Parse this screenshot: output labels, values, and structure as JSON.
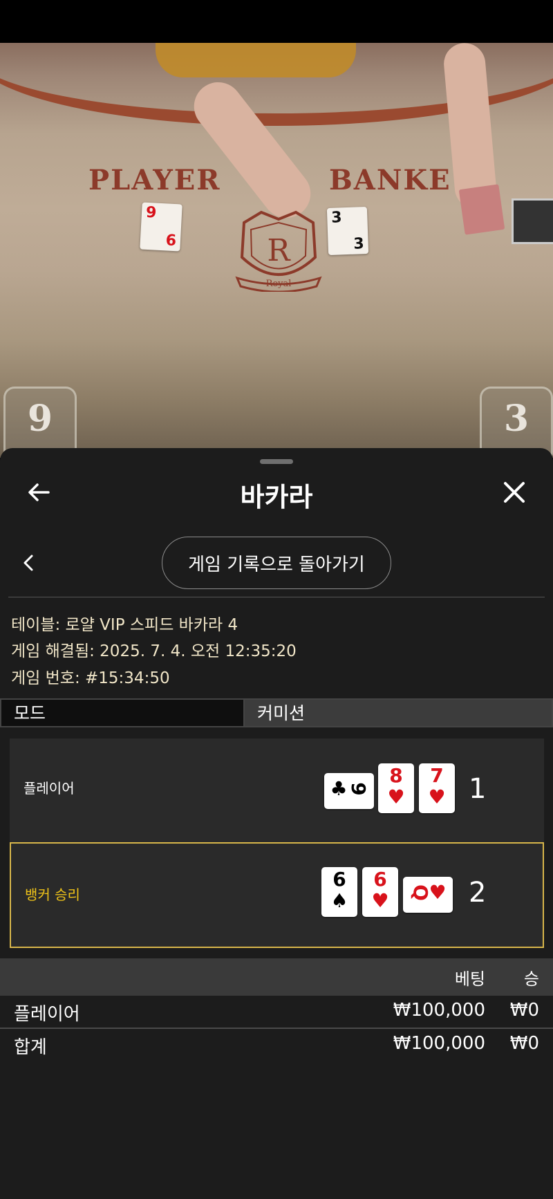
{
  "video": {
    "table_player_word": "PLAYER",
    "table_banker_word": "BANKE",
    "logo_letter": "R",
    "logo_text": "Royal",
    "player_score": "9",
    "banker_score": "3",
    "table_cards": [
      {
        "rank_top": "9",
        "rank_bottom": "6",
        "color": "#d8121b"
      },
      {
        "rank_top": "3",
        "rank_bottom": "3",
        "color": "#111111"
      }
    ]
  },
  "header": {
    "title": "바카라",
    "back_icon": "arrow-left-icon",
    "close_icon": "close-icon"
  },
  "history": {
    "prev_icon": "chevron-left-icon",
    "back_button_label": "게임 기록으로 돌아가기"
  },
  "info": {
    "table_line": "테이블: 로얄 VIP 스피드 바카라 4",
    "resolved_line": "게임 해결됨: 2025. 7. 4. 오전 12:35:20",
    "game_number_line": "게임 번호: #15:34:50"
  },
  "tabs": {
    "mode": "모드",
    "commission": "커미션"
  },
  "hands": {
    "player": {
      "label": "플레이어",
      "label_color": "#ffffff",
      "score": "1",
      "cards": [
        {
          "rank": "9",
          "suit": "♣",
          "color": "#000000",
          "orientation": "sideways"
        },
        {
          "rank": "8",
          "suit": "♥",
          "color": "#d8121b",
          "orientation": "upright"
        },
        {
          "rank": "7",
          "suit": "♥",
          "color": "#d8121b",
          "orientation": "upright"
        }
      ]
    },
    "banker": {
      "label": "뱅커 승리",
      "label_color": "#f0c419",
      "score": "2",
      "winner": true,
      "cards": [
        {
          "rank": "6",
          "suit": "♠",
          "color": "#000000",
          "orientation": "upright"
        },
        {
          "rank": "6",
          "suit": "♥",
          "color": "#d8121b",
          "orientation": "upright"
        },
        {
          "rank": "Q",
          "suit": "♥",
          "color": "#d8121b",
          "orientation": "sideways"
        }
      ]
    }
  },
  "bets": {
    "header_bet": "베팅",
    "header_win": "승",
    "rows": [
      {
        "name": "플레이어",
        "bet": "₩100,000",
        "win": "₩0"
      }
    ],
    "total": {
      "name": "합계",
      "bet": "₩100,000",
      "win": "₩0"
    }
  },
  "colors": {
    "panel_bg": "#1c1c1c",
    "winner_border": "#d8b64b",
    "info_text": "#f1e6c8"
  }
}
